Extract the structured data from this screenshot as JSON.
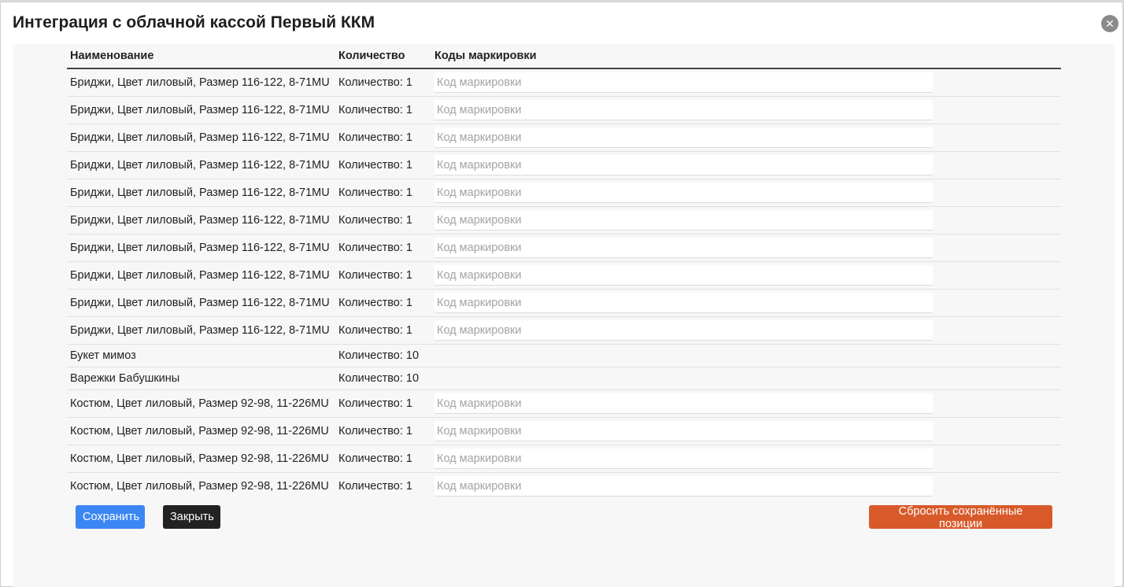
{
  "modal": {
    "title": "Интеграция с облачной кассой Первый ККМ",
    "close_icon": "close-icon"
  },
  "table": {
    "headers": {
      "name": "Наименование",
      "quantity": "Количество",
      "codes": "Коды маркировки"
    },
    "rows": [
      {
        "name": "Бриджи, Цвет лиловый, Размер 116-122, 8-71MU",
        "quantity": "Количество: 1",
        "has_input": true,
        "placeholder": "Код маркировки"
      },
      {
        "name": "Бриджи, Цвет лиловый, Размер 116-122, 8-71MU",
        "quantity": "Количество: 1",
        "has_input": true,
        "placeholder": "Код маркировки"
      },
      {
        "name": "Бриджи, Цвет лиловый, Размер 116-122, 8-71MU",
        "quantity": "Количество: 1",
        "has_input": true,
        "placeholder": "Код маркировки"
      },
      {
        "name": "Бриджи, Цвет лиловый, Размер 116-122, 8-71MU",
        "quantity": "Количество: 1",
        "has_input": true,
        "placeholder": "Код маркировки"
      },
      {
        "name": "Бриджи, Цвет лиловый, Размер 116-122, 8-71MU",
        "quantity": "Количество: 1",
        "has_input": true,
        "placeholder": "Код маркировки"
      },
      {
        "name": "Бриджи, Цвет лиловый, Размер 116-122, 8-71MU",
        "quantity": "Количество: 1",
        "has_input": true,
        "placeholder": "Код маркировки"
      },
      {
        "name": "Бриджи, Цвет лиловый, Размер 116-122, 8-71MU",
        "quantity": "Количество: 1",
        "has_input": true,
        "placeholder": "Код маркировки"
      },
      {
        "name": "Бриджи, Цвет лиловый, Размер 116-122, 8-71MU",
        "quantity": "Количество: 1",
        "has_input": true,
        "placeholder": "Код маркировки"
      },
      {
        "name": "Бриджи, Цвет лиловый, Размер 116-122, 8-71MU",
        "quantity": "Количество: 1",
        "has_input": true,
        "placeholder": "Код маркировки"
      },
      {
        "name": "Бриджи, Цвет лиловый, Размер 116-122, 8-71MU",
        "quantity": "Количество: 1",
        "has_input": true,
        "placeholder": "Код маркировки"
      },
      {
        "name": "Букет мимоз",
        "quantity": "Количество: 10",
        "has_input": false,
        "placeholder": ""
      },
      {
        "name": "Варежки Бабушкины",
        "quantity": "Количество: 10",
        "has_input": false,
        "placeholder": ""
      },
      {
        "name": "Костюм, Цвет лиловый, Размер 92-98, 11-226MU",
        "quantity": "Количество: 1",
        "has_input": true,
        "placeholder": "Код маркировки"
      },
      {
        "name": "Костюм, Цвет лиловый, Размер 92-98, 11-226MU",
        "quantity": "Количество: 1",
        "has_input": true,
        "placeholder": "Код маркировки"
      },
      {
        "name": "Костюм, Цвет лиловый, Размер 92-98, 11-226MU",
        "quantity": "Количество: 1",
        "has_input": true,
        "placeholder": "Код маркировки"
      },
      {
        "name": "Костюм, Цвет лиловый, Размер 92-98, 11-226MU",
        "quantity": "Количество: 1",
        "has_input": true,
        "placeholder": "Код маркировки"
      }
    ]
  },
  "footer": {
    "save_label": "Сохранить",
    "close_label": "Закрыть",
    "reset_label": "Сбросить сохранённые позиции"
  },
  "colors": {
    "save": "#3b86f3",
    "close": "#222222",
    "reset": "#d85a2a"
  }
}
